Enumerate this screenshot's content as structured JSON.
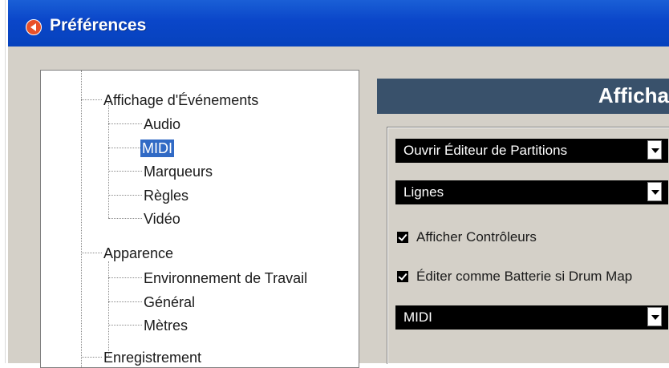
{
  "window": {
    "title": "Préférences"
  },
  "tree": {
    "items": [
      {
        "label": "Affichage d'Événements",
        "level": 0,
        "selected": false
      },
      {
        "label": "Audio",
        "level": 1,
        "selected": false
      },
      {
        "label": "MIDI",
        "level": 1,
        "selected": true
      },
      {
        "label": "Marqueurs",
        "level": 1,
        "selected": false
      },
      {
        "label": "Règles",
        "level": 1,
        "selected": false
      },
      {
        "label": "Vidéo",
        "level": 1,
        "selected": false
      },
      {
        "label": "Apparence",
        "level": 0,
        "selected": false
      },
      {
        "label": "Environnement de Travail",
        "level": 1,
        "selected": false
      },
      {
        "label": "Général",
        "level": 1,
        "selected": false
      },
      {
        "label": "Mètres",
        "level": 1,
        "selected": false
      },
      {
        "label": "Enregistrement",
        "level": 0,
        "selected": false
      }
    ]
  },
  "panel": {
    "header_title": "Afficha",
    "dropdown_editor": "Ouvrir Éditeur de Partitions",
    "dropdown_lines": "Lignes",
    "checkbox_controllers": "Afficher Contrôleurs",
    "checkbox_drum": "Éditer comme Batterie si Drum Map",
    "dropdown_midi": "MIDI"
  },
  "colors": {
    "titlebar": "#0a46c9",
    "selection": "#316ac5",
    "header": "#39516b",
    "dialog_face": "#d4d0c8"
  }
}
